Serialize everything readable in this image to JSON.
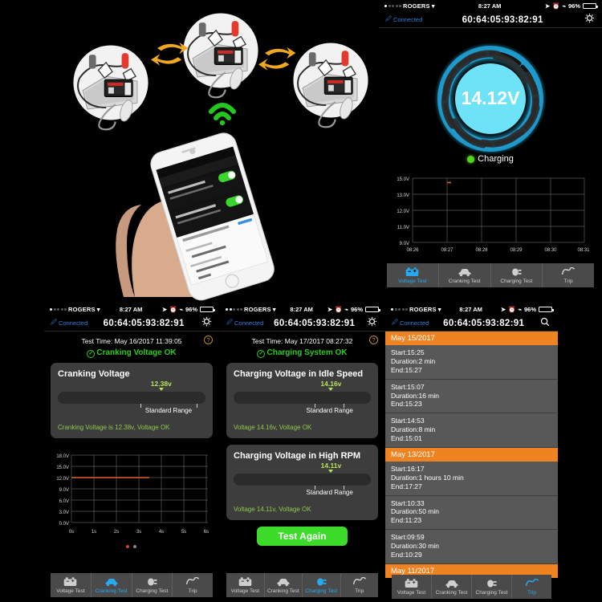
{
  "statusbar": {
    "carrier": "ROGERS",
    "time": "8:27 AM",
    "battery": "96%"
  },
  "navbar": {
    "connected": "Connected",
    "mac": "60:64:05:93:82:91"
  },
  "tabs": [
    {
      "label": "Voltage Test",
      "icon": "battery-icon"
    },
    {
      "label": "Cranking Test",
      "icon": "car-icon"
    },
    {
      "label": "Charging Test",
      "icon": "plug-icon"
    },
    {
      "label": "Trip",
      "icon": "wave-icon"
    }
  ],
  "voltage_panel": {
    "gauge_value": "14.12V",
    "status": "Charging",
    "status_color": "#53d51f",
    "active_tab": "Voltage Test"
  },
  "cranking_panel": {
    "test_time_label": "Test Time:",
    "test_time_value": "May 16/2017 11:39:05",
    "help": "?",
    "ok_status": "Cranking Voltage OK",
    "card_title": "Cranking Voltage",
    "meter_value": "12.38v",
    "range_label": "Standard Range",
    "card_foot": "Cranking Voltage is 12.38v, Voltage OK",
    "active_tab": "Cranking Test"
  },
  "charging_panel": {
    "test_time_label": "Test Time:",
    "test_time_value": "May 17/2017 08:27:32",
    "help": "?",
    "ok_status": "Charging System OK",
    "idle": {
      "title": "Charging Voltage in Idle Speed",
      "meter_value": "14.16v",
      "range_label": "Standard Range",
      "foot": "Voltage 14.16v, Voltage OK"
    },
    "high_rpm": {
      "title": "Charging Voltage in High RPM",
      "meter_value": "14.11v",
      "range_label": "Standard Range",
      "foot": "Voltage 14.11v, Voltage OK"
    },
    "test_again": "Test Again",
    "active_tab": "Charging Test"
  },
  "trip_panel": {
    "search_icon": "search-icon",
    "active_tab": "Trip",
    "groups": [
      {
        "date": "May 15/2017",
        "trips": [
          {
            "start": "Start:15:25",
            "duration": "Duration:2 min",
            "end": "End:15:27"
          },
          {
            "start": "Start:15:07",
            "duration": "Duration:16 min",
            "end": "End:15:23"
          },
          {
            "start": "Start:14:53",
            "duration": "Duration:8 min",
            "end": "End:15:01"
          }
        ]
      },
      {
        "date": "May 13/2017",
        "trips": [
          {
            "start": "Start:16:17",
            "duration": "Duration:1 hours 10 min",
            "end": "End:17:27"
          },
          {
            "start": "Start:10:33",
            "duration": "Duration:50 min",
            "end": "End:11:23"
          },
          {
            "start": "Start:09:59",
            "duration": "Duration:30 min",
            "end": "End:10:29"
          }
        ]
      },
      {
        "date": "May 11/2017",
        "trips": []
      }
    ]
  },
  "illustration": {
    "alt": "battery-monitor-install-steps",
    "wifi_icon": "wifi-signal-icon",
    "arrow_icon": "swap-arrow-icon",
    "phone_icon": "hand-holding-phone"
  },
  "chart_data": [
    {
      "type": "line",
      "id": "voltage-test-chart",
      "title": "",
      "xlabel": "",
      "ylabel": "",
      "yticks": [
        "15.0V",
        "13.0V",
        "12.0V",
        "11.0V",
        "9.0V"
      ],
      "yvalues": [
        15.0,
        13.0,
        12.0,
        11.0,
        9.0
      ],
      "xticks": [
        "08:26",
        "08:27",
        "08:28",
        "08:29",
        "08:30",
        "08:31"
      ],
      "ylim": [
        9.0,
        15.0
      ],
      "grid": true,
      "series": [
        {
          "name": "voltage",
          "color": "#e2622a",
          "x": [
            "08:27"
          ],
          "values": [
            14.4
          ]
        }
      ]
    },
    {
      "type": "line",
      "id": "cranking-test-chart",
      "title": "",
      "xlabel": "",
      "ylabel": "",
      "yticks": [
        "18.0V",
        "15.0V",
        "12.0V",
        "9.0V",
        "6.0V",
        "3.0V",
        "0.0V"
      ],
      "yvalues": [
        18.0,
        15.0,
        12.0,
        9.0,
        6.0,
        3.0,
        0.0
      ],
      "xticks": [
        "0s",
        "1s",
        "2s",
        "3s",
        "4s",
        "5s",
        "6s"
      ],
      "ylim": [
        0.0,
        18.0
      ],
      "grid": true,
      "series": [
        {
          "name": "cranking voltage",
          "color": "#e2622a",
          "x": [
            0,
            1,
            2,
            3,
            3.4
          ],
          "values": [
            12.38,
            12.38,
            12.38,
            12.38,
            12.38
          ]
        }
      ]
    }
  ]
}
